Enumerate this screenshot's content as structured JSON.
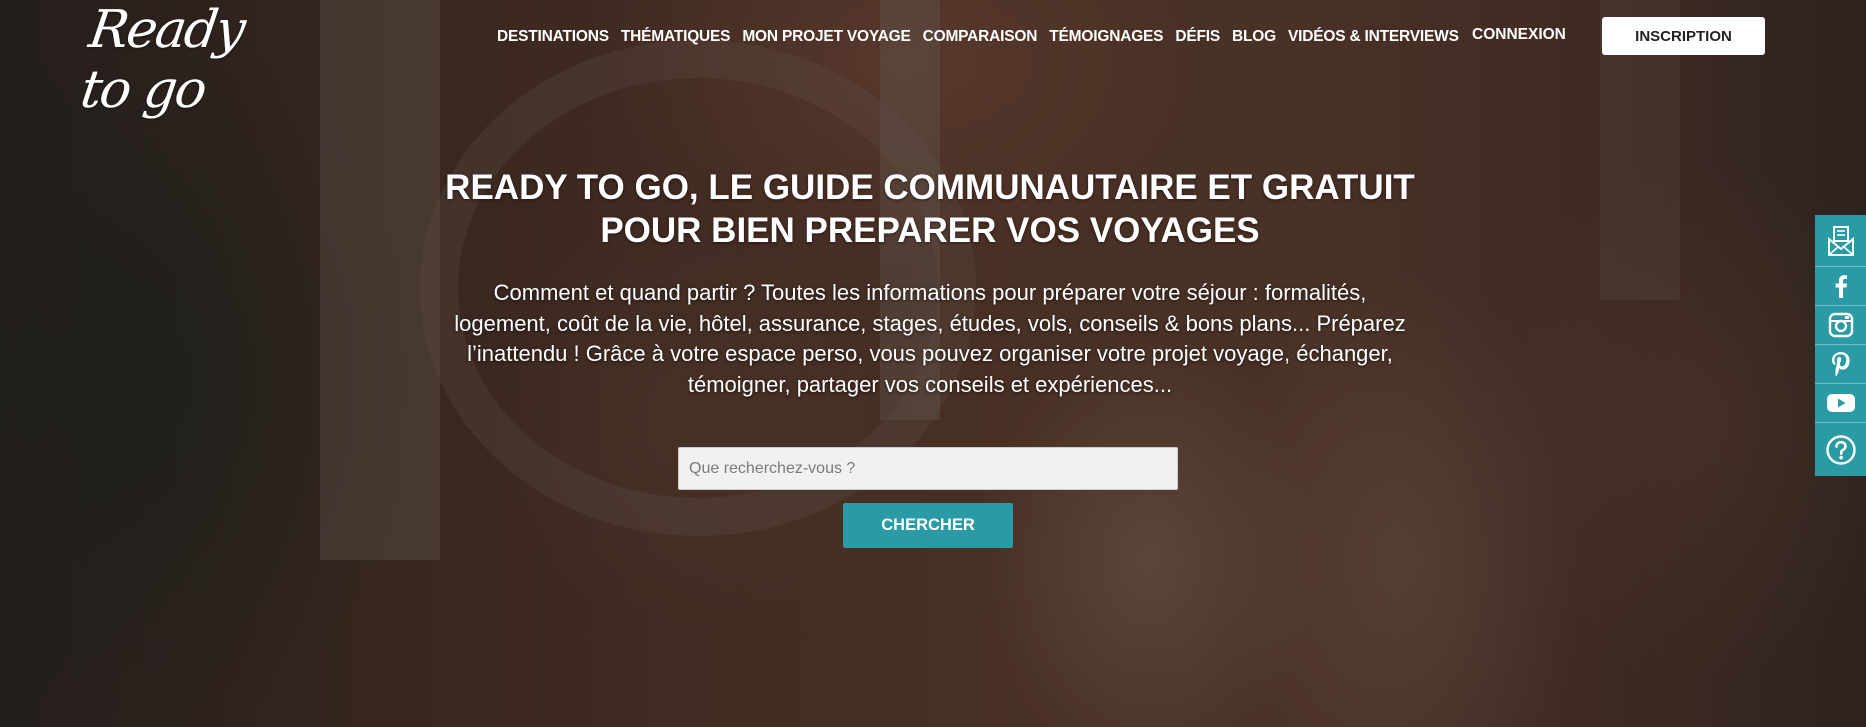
{
  "brand": {
    "logo_text": "Ready to go"
  },
  "nav": {
    "items": [
      {
        "label": "DESTINATIONS"
      },
      {
        "label": "THÉMATIQUES"
      },
      {
        "label": "MON PROJET VOYAGE"
      },
      {
        "label": "COMPARAISON"
      },
      {
        "label": "TÉMOIGNAGES"
      },
      {
        "label": "DÉFIS"
      },
      {
        "label": "BLOG"
      },
      {
        "label": "VIDÉOS & INTERVIEWS"
      }
    ],
    "login_label": "CONNEXION",
    "signup_label": "INSCRIPTION"
  },
  "hero": {
    "title_lines": [
      "READY TO GO, LE GUIDE COMMUNAUTAIRE ET GRATUIT",
      "POUR BIEN PREPARER VOS VOYAGES"
    ],
    "intro_lines": [
      "Comment et quand partir ? Toutes les informations pour préparer votre séjour : formalités,",
      "logement, coût de la vie, hôtel, assurance, stages, études, vols, conseils & bons plans... Préparez",
      "l’inattendu ! Grâce à votre espace perso, vous pouvez organiser votre projet voyage, échanger,",
      "témoigner, partager vos conseils et expériences..."
    ]
  },
  "search": {
    "placeholder": "Que recherchez-vous ?",
    "value": "",
    "button_label": "CHERCHER"
  },
  "social": {
    "items": [
      {
        "icon": "newsletter-icon"
      },
      {
        "icon": "facebook-icon"
      },
      {
        "icon": "instagram-icon"
      },
      {
        "icon": "pinterest-icon"
      },
      {
        "icon": "youtube-icon"
      },
      {
        "icon": "help-icon"
      }
    ]
  },
  "colors": {
    "accent": "#2a9aa5",
    "signup_bg": "#ffffff",
    "overlay": "#141212"
  }
}
